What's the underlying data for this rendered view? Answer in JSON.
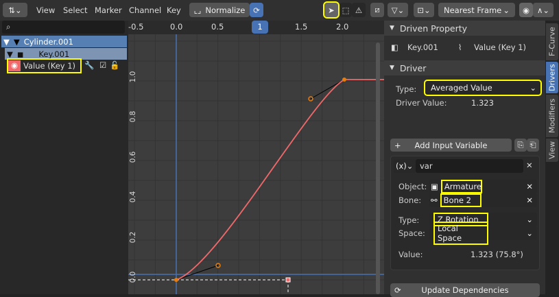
{
  "header": {
    "menus": [
      "View",
      "Select",
      "Marker",
      "Channel",
      "Key"
    ],
    "normalize": "Normalize",
    "snap": "Nearest Frame"
  },
  "channels": {
    "search_placeholder": "",
    "object": "Cylinder.001",
    "key": "Key.001",
    "fcurve": "Value (Key 1)"
  },
  "ruler": {
    "ticks": [
      "-0.5",
      "0.0",
      "0.5",
      "1.5",
      "2.0"
    ],
    "current_frame": "1"
  },
  "yaxis": {
    "ticks": [
      "1.0",
      "0.8",
      "0.6",
      "0.4",
      "0.2",
      "0.0"
    ]
  },
  "panel": {
    "driven_title": "Driven Property",
    "driven_id": "Key.001",
    "driven_prop": "Value (Key 1)",
    "driver_title": "Driver",
    "type_label": "Type:",
    "type_value": "Averaged Value",
    "driver_value_label": "Driver Value:",
    "driver_value": "1.323",
    "add_var": "Add Input Variable",
    "var_type": "(x)",
    "var_name": "var",
    "object_label": "Object:",
    "object_value": "Armature",
    "bone_label": "Bone:",
    "bone_value": "Bone 2",
    "vtype_label": "Type:",
    "vtype_value": "Z Rotation",
    "space_label": "Space:",
    "space_value": "Local Space",
    "value_label": "Value:",
    "value": "1.323 (75.8°)",
    "update": "Update Dependencies"
  },
  "tabs": [
    "F-Curve",
    "Drivers",
    "Modifiers",
    "View"
  ],
  "colors": {
    "curve": "#f0686a",
    "handle": "#e87d0d",
    "accent": "#4772b3",
    "highlight": "#ffff00"
  }
}
